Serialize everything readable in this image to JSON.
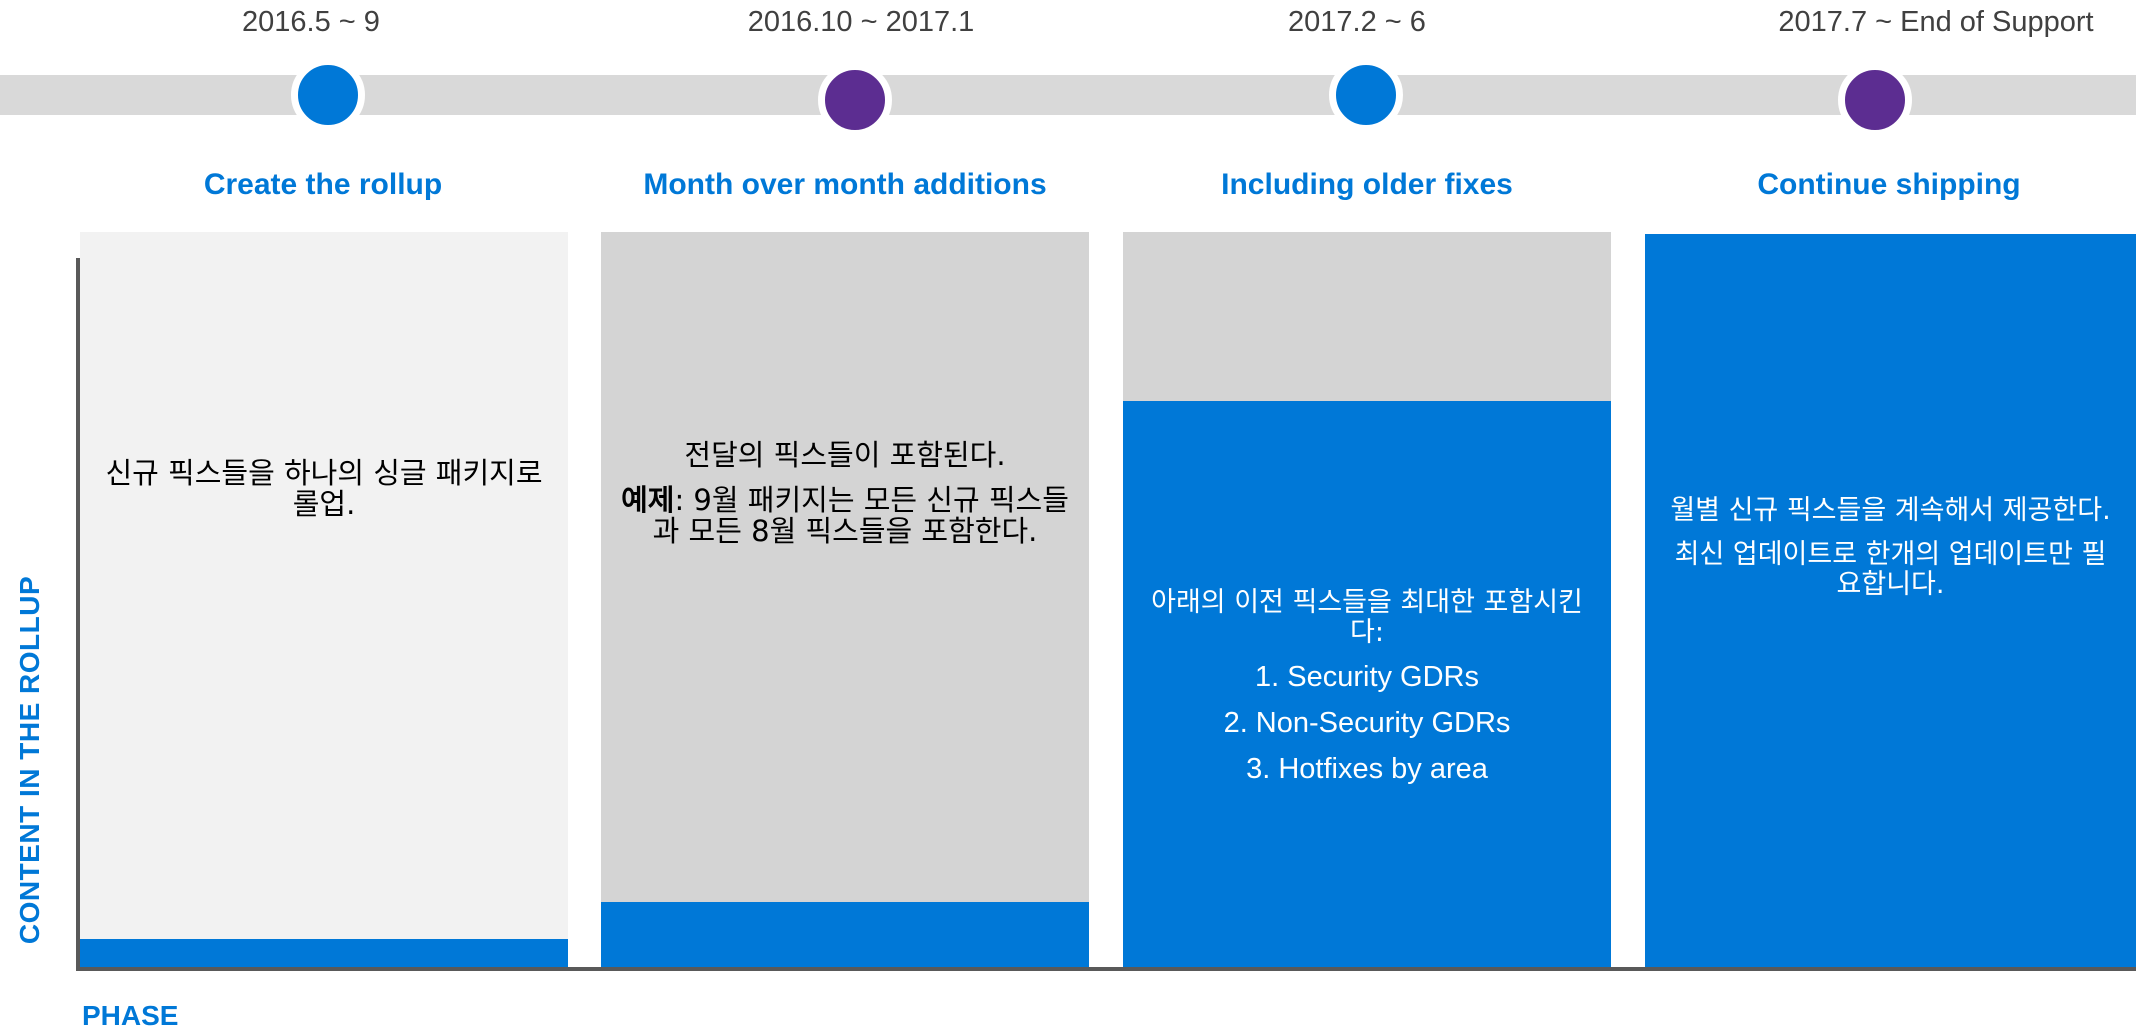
{
  "colors": {
    "accent_blue": "#0078d7",
    "accent_purple": "#5c2d91",
    "timeline_grey": "#d9d9d9",
    "panel_light": "#f2f2f2",
    "panel_mid": "#d4d4d4"
  },
  "timeline": {
    "dates": [
      "2016.5 ~ 9",
      "2016.10 ~ 2017.1",
      "2017.2 ~ 6",
      "2017.7 ~ End of Support"
    ]
  },
  "phases": [
    {
      "title": "Create the rollup",
      "marker_color": "#0078d7",
      "panel_color": "#f2f2f2",
      "fill_fraction": 0.04,
      "text": [
        "신규 픽스들을 하나의 싱글 패키지로 롤업."
      ]
    },
    {
      "title": "Month over month additions",
      "marker_color": "#5c2d91",
      "panel_color": "#d4d4d4",
      "fill_fraction": 0.09,
      "text": [
        "전달의 픽스들이 포함된다."
      ],
      "example_label": "예제",
      "example_text": ": 9월 패키지는 모든 신규 픽스들과 모든 8월 픽스들을 포함한다."
    },
    {
      "title": "Including older fixes",
      "marker_color": "#0078d7",
      "panel_color": "#d4d4d4",
      "fill_fraction": 0.77,
      "text": [
        "아래의 이전 픽스들을 최대한 포함시킨다:"
      ],
      "list": [
        "1. Security GDRs",
        "2. Non-Security GDRs",
        "3. Hotfixes by area"
      ]
    },
    {
      "title": "Continue shipping",
      "marker_color": "#5c2d91",
      "panel_color": "#0078d7",
      "fill_fraction": 1.0,
      "text": [
        "월별 신규 픽스들을 계속해서 제공한다.",
        "최신 업데이트로 한개의 업데이트만 필요합니다."
      ]
    }
  ],
  "axes": {
    "y_label": "CONTENT IN THE ROLLUP",
    "x_label": "PHASE"
  }
}
